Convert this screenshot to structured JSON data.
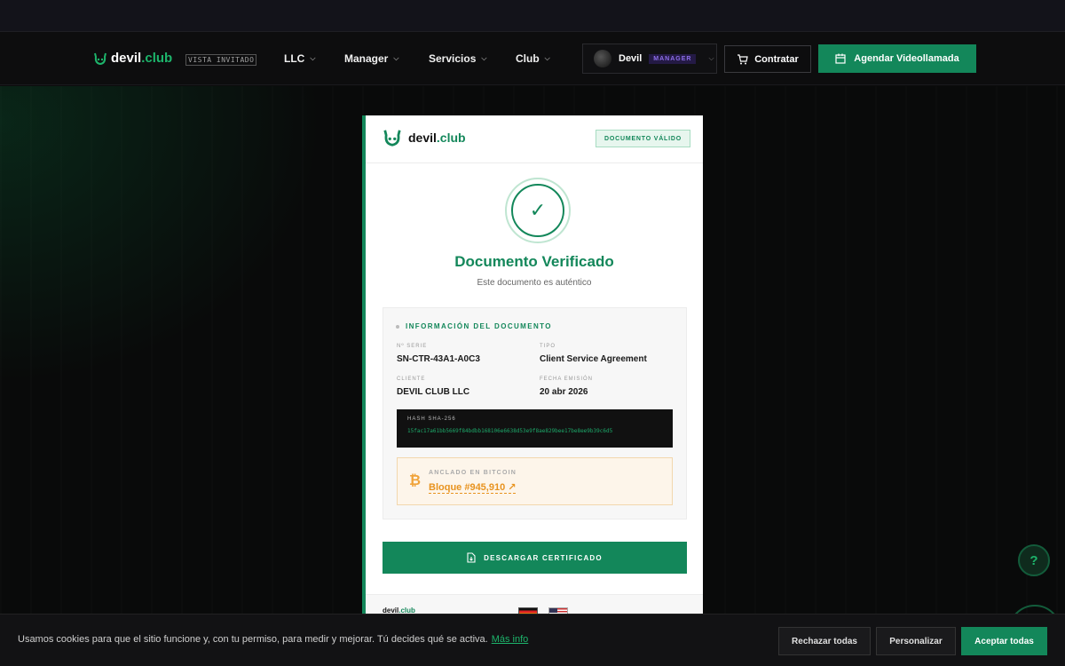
{
  "brand": {
    "name_main": "devil",
    "name_accent": ".club",
    "accent_color": "#13875a"
  },
  "header": {
    "guest_badge": "VISTA INVITADO",
    "nav": [
      {
        "label": "LLC"
      },
      {
        "label": "Manager"
      },
      {
        "label": "Servicios"
      },
      {
        "label": "Club"
      }
    ],
    "user": {
      "name": "Devil",
      "role": "MANAGER"
    },
    "contract_label": "Contratar",
    "schedule_label": "Agendar Videollamada"
  },
  "certificate": {
    "status_badge": "DOCUMENTO VÁLIDO",
    "title": "Documento Verificado",
    "subtitle": "Este documento es auténtico",
    "info_title": "INFORMACIÓN DEL DOCUMENTO",
    "fields": {
      "serial_label": "Nº SERIE",
      "serial_value": "SN-CTR-43A1-A0C3",
      "type_label": "TIPO",
      "type_value": "Client Service Agreement",
      "client_label": "CLIENTE",
      "client_value": "DEVIL CLUB LLC",
      "date_label": "FECHA EMISIÓN",
      "date_value": "20 abr 2026"
    },
    "hash_label": "HASH SHA-256",
    "hash_value": "15fac17a61bb5669f84bdbb168106e6638d53e9f8ae829bee17be8ee9b39c6d5",
    "bitcoin_label": "ANCLADO EN BITCOIN",
    "bitcoin_block": "Bloque #945,910 ↗",
    "download_label": "DESCARGAR CERTIFICADO",
    "footer_logo_main": "devil",
    "footer_logo_accent": ".club"
  },
  "cookies": {
    "text": "Usamos cookies para que el sitio funcione y, con tu permiso, para medir y mejorar. Tú decides qué se activa.",
    "more_link": "Más info",
    "reject": "Rechazar todas",
    "customize": "Personalizar",
    "accept": "Aceptar todas"
  },
  "icons": {
    "help": "help-icon",
    "cart": "cart-icon",
    "calendar": "calendar-icon",
    "check": "check-icon",
    "bitcoin": "bitcoin-icon",
    "document": "document-download-icon"
  }
}
